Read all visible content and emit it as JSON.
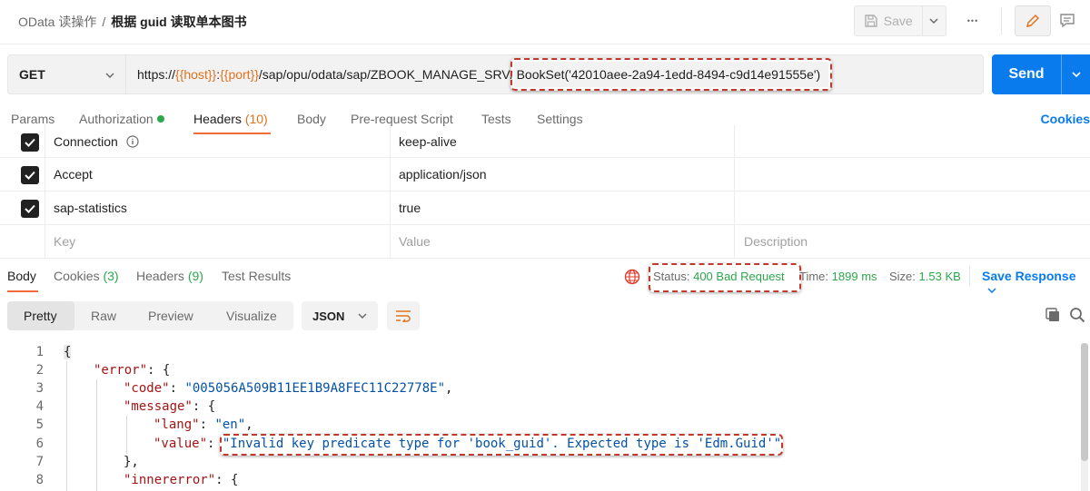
{
  "breadcrumb": {
    "parent": "OData 读操作",
    "separator": "/",
    "current": "根据 guid 读取单本图书"
  },
  "toolbar": {
    "save_label": "Save",
    "more_label": "•••"
  },
  "request": {
    "method": "GET",
    "url_prefix": "https://",
    "url_host_var": "{{host}}",
    "url_colon": ":",
    "url_port_var": "{{port}}",
    "url_path": "/sap/opu/odata/sap/ZBOOK_MANAGE_SRV/",
    "url_highlight": "BookSet('42010aee-2a94-1edd-8494-c9d14e91555e')",
    "send_label": "Send"
  },
  "request_tabs": {
    "params": "Params",
    "authorization": "Authorization",
    "headers_label": "Headers",
    "headers_count": "(10)",
    "body": "Body",
    "prerequest": "Pre-request Script",
    "tests": "Tests",
    "settings": "Settings",
    "cookies": "Cookies"
  },
  "headers_table": {
    "rows": [
      {
        "key": "Connection",
        "value": "keep-alive",
        "info": true
      },
      {
        "key": "Accept",
        "value": "application/json"
      },
      {
        "key": "sap-statistics",
        "value": "true"
      }
    ],
    "placeholder": {
      "key": "Key",
      "value": "Value",
      "description": "Description"
    }
  },
  "response_tabs": {
    "body": "Body",
    "cookies_label": "Cookies",
    "cookies_count": "(3)",
    "headers_label": "Headers",
    "headers_count": "(9)",
    "test_results": "Test Results"
  },
  "response_meta": {
    "status_label": "Status:",
    "status_value": "400 Bad Request",
    "time_label": "Time:",
    "time_value": "1899 ms",
    "size_label": "Size:",
    "size_value": "1.53 KB",
    "save_response": "Save Response"
  },
  "view_modes": {
    "pretty": "Pretty",
    "raw": "Raw",
    "preview": "Preview",
    "visualize": "Visualize",
    "format": "JSON"
  },
  "code_lines": [
    {
      "n": "1",
      "t": "{"
    },
    {
      "n": "2",
      "k": "\"error\"",
      "t": ": {"
    },
    {
      "n": "3",
      "k": "\"code\"",
      "sep": ": ",
      "v": "\"005056A509B11EE1B9A8FEC11C22778E\"",
      "t": ","
    },
    {
      "n": "4",
      "k": "\"message\"",
      "t": ": {"
    },
    {
      "n": "5",
      "k": "\"lang\"",
      "sep": ": ",
      "v": "\"en\"",
      "t": ","
    },
    {
      "n": "6",
      "k": "\"value\"",
      "sep": ": ",
      "v": "\"Invalid key predicate type for 'book_guid'. Expected type is 'Edm.Guid'\""
    },
    {
      "n": "7",
      "t": "},"
    },
    {
      "n": "8",
      "k": "\"innererror\"",
      "t": ": {"
    }
  ],
  "colors": {
    "accent": "#097bed",
    "orange": "#e2721d",
    "green": "#2ba84a",
    "tab_underline": "#f26b3a",
    "highlight_border": "#c0392b"
  }
}
